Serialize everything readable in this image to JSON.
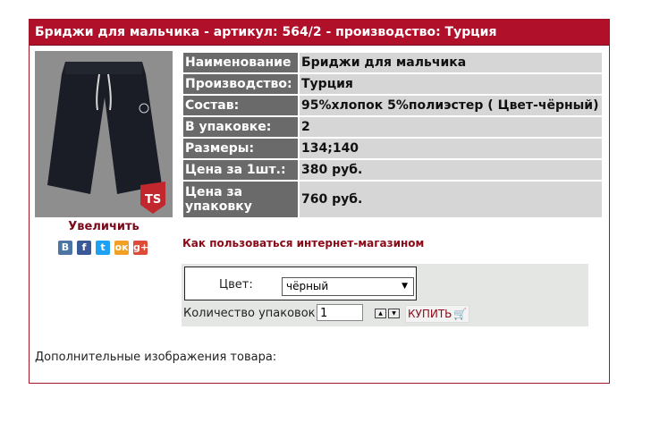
{
  "product": {
    "title": "Бриджи для мальчика - артикул: 564/2 - производство: Турция",
    "enlarge_label": "Увеличить",
    "howto_link": "Как пользоваться интернет-магазином",
    "more_images_label": "Дополнительные изображения товара:",
    "image_logo_text": "TS"
  },
  "social": [
    {
      "label": "В",
      "name": "vk-icon",
      "color": "#4c75a3"
    },
    {
      "label": "f",
      "name": "facebook-icon",
      "color": "#3b5998"
    },
    {
      "label": "t",
      "name": "twitter-icon",
      "color": "#1da1f2"
    },
    {
      "label": "ок",
      "name": "odnoklassniki-icon",
      "color": "#f2a025"
    },
    {
      "label": "g+",
      "name": "google-plus-icon",
      "color": "#dd4b39"
    }
  ],
  "specs": [
    {
      "label": "Наименование",
      "value": "Бриджи для мальчика"
    },
    {
      "label": "Производство:",
      "value": "Турция"
    },
    {
      "label": "Состав:",
      "value": "95%хлопок 5%полиэстер ( Цвет-чёрный)"
    },
    {
      "label": "В упаковке:",
      "value": "2"
    },
    {
      "label": "Размеры:",
      "value": "134;140"
    },
    {
      "label": "Цена за 1шт.:",
      "value": "380 руб."
    },
    {
      "label": "Цена за упаковку",
      "value": "760 руб."
    }
  ],
  "order": {
    "color_label": "Цвет:",
    "color_value": "чёрный",
    "qty_label": "Количество упаковок:",
    "qty_value": "1",
    "buy_label": "КУПИТЬ"
  },
  "colors": {
    "accent": "#b0102a",
    "label_bg": "#6a6a6a",
    "value_bg": "#d6d6d6",
    "link": "#8b0a18"
  }
}
